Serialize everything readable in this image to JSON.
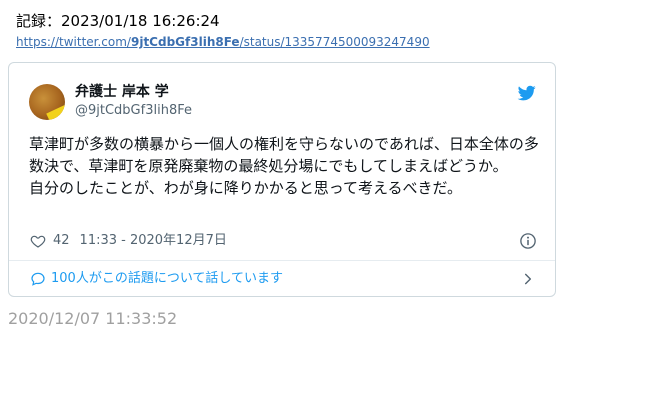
{
  "record": {
    "text": "記録：2023/01/18 16:26:24"
  },
  "source_link": {
    "prefix": "https://twitter.com/",
    "user": "9jtCdbGf3lih8Fe",
    "suffix": "/status/1335774500093247490"
  },
  "tweet": {
    "display_name": "弁護士 岸本 学",
    "handle": "@9jtCdbGf3lih8Fe",
    "text_line1": "草津町が多数の横暴から一個人の権利を守らないのであれば、日本全体の多数決で、草津町を原発廃棄物の最終処分場にでもしてしまえばどうか。",
    "text_line2": "自分のしたことが、わが身に降りかかると思って考えるべきだ。",
    "likes": "42",
    "timestamp": "11:33 - 2020年12月7日",
    "conversation": "100人がこの話題について話しています",
    "icons": {
      "avatar": "avatar-photo",
      "brand": "twitter-bird-icon",
      "like": "heart-icon",
      "info": "info-icon",
      "reply": "speech-bubble-icon",
      "more": "chevron-right-icon"
    },
    "colors": {
      "brand": "#1d9bf0",
      "secondary_text": "#536471",
      "link": "#3b6fb0"
    }
  },
  "capture_timestamp": "2020/12/07 11:33:52"
}
